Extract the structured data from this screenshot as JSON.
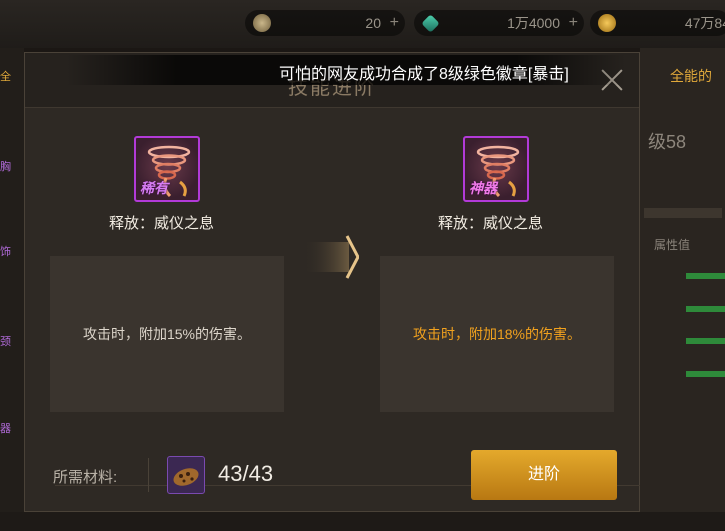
{
  "topbar": {
    "resources": [
      {
        "icon": "moon-coin-icon",
        "value": "20",
        "plus": "+"
      },
      {
        "icon": "green-gem-icon",
        "value": "1万4000",
        "plus": "+"
      },
      {
        "icon": "gold-coin-icon",
        "value": "47万84"
      }
    ]
  },
  "background": {
    "right_tab": "全能的",
    "level_text": "级58",
    "attr_label": "属性值"
  },
  "dialog": {
    "title": "技能进阶",
    "notice": "可怕的网友成功合成了8级绿色徽章[暴击]",
    "current": {
      "rarity": "稀有",
      "name": "释放：威仪之息",
      "desc": "攻击时，附加15%的伤害。"
    },
    "next": {
      "rarity": "神器",
      "name": "释放：威仪之息",
      "desc": "攻击时，附加18%的伤害。"
    },
    "materials_label": "所需材料:",
    "materials_count": "43/43",
    "advance_label": "进阶"
  },
  "colors": {
    "accent": "#e0a83a",
    "highlight_text": "#f2a21e",
    "rare_purple": "#b23ad8",
    "button_gold": "#d6961e"
  }
}
